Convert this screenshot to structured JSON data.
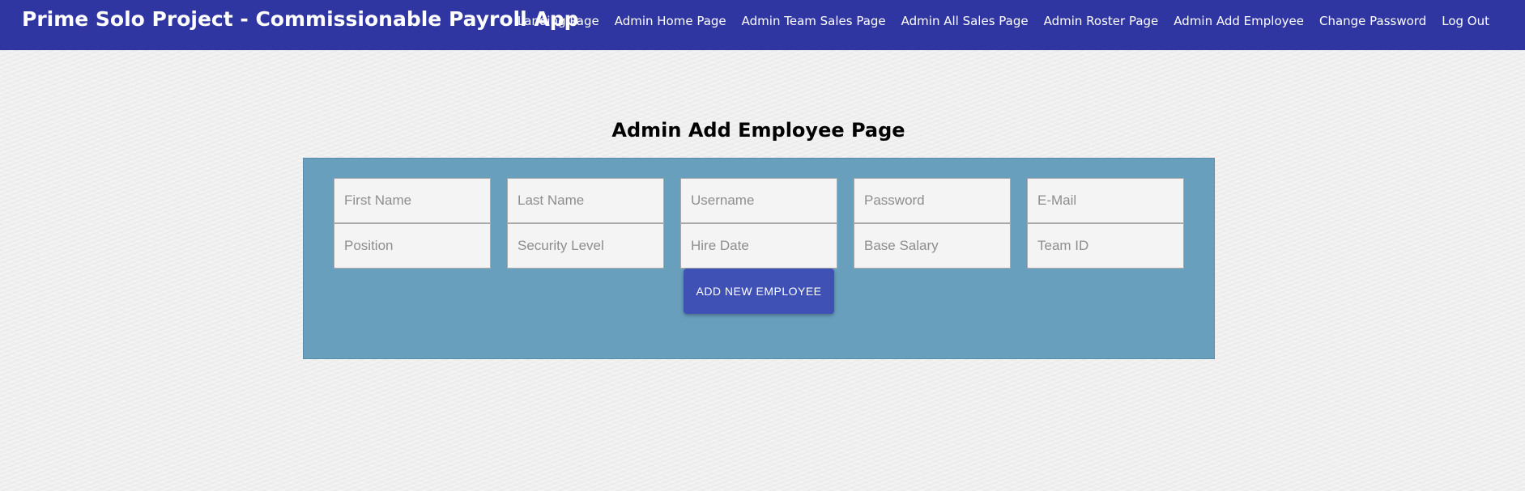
{
  "app": {
    "title": "Prime Solo Project - Commissionable Payroll App"
  },
  "nav": {
    "links": [
      {
        "label": "Landing Page"
      },
      {
        "label": "Admin Home Page"
      },
      {
        "label": "Admin Team Sales Page"
      },
      {
        "label": "Admin All Sales Page"
      },
      {
        "label": "Admin Roster Page"
      },
      {
        "label": "Admin Add Employee"
      },
      {
        "label": "Change Password"
      },
      {
        "label": "Log Out"
      }
    ]
  },
  "page": {
    "title": "Admin Add Employee Page"
  },
  "form": {
    "fields": [
      {
        "placeholder": "First Name",
        "value": ""
      },
      {
        "placeholder": "Last Name",
        "value": ""
      },
      {
        "placeholder": "Username",
        "value": ""
      },
      {
        "placeholder": "Password",
        "value": ""
      },
      {
        "placeholder": "E-Mail",
        "value": ""
      },
      {
        "placeholder": "Position",
        "value": ""
      },
      {
        "placeholder": "Security Level",
        "value": ""
      },
      {
        "placeholder": "Hire Date",
        "value": ""
      },
      {
        "placeholder": "Base Salary",
        "value": ""
      },
      {
        "placeholder": "Team ID",
        "value": ""
      }
    ],
    "submit_label": "ADD NEW EMPLOYEE"
  },
  "colors": {
    "nav_background": "#2f36a1",
    "panel_background": "#689fbd",
    "button_background": "#3f51b5"
  }
}
